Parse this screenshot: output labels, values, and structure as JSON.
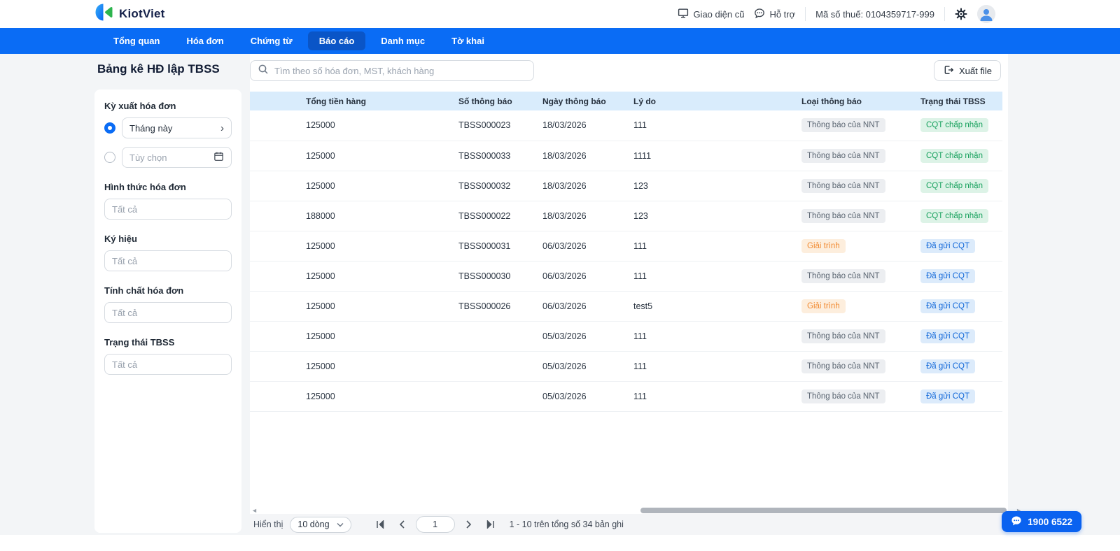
{
  "header": {
    "brand": "KiotViet",
    "old_ui": "Giao diện cũ",
    "support": "Hỗ trợ",
    "tax_code": "Mã số thuế: 0104359717-999"
  },
  "nav": {
    "items": [
      {
        "label": "Tổng quan",
        "active": false
      },
      {
        "label": "Hóa đơn",
        "active": false
      },
      {
        "label": "Chứng từ",
        "active": false
      },
      {
        "label": "Báo cáo",
        "active": true
      },
      {
        "label": "Danh mục",
        "active": false
      },
      {
        "label": "Tờ khai",
        "active": false
      }
    ]
  },
  "page": {
    "title": "Bảng kê HĐ lập TBSS",
    "search_placeholder": "Tìm theo số hóa đơn, MST, khách hàng",
    "export_label": "Xuất file"
  },
  "filters": {
    "period": {
      "label": "Kỳ xuất hóa đơn",
      "this_month": "Tháng này",
      "custom": "Tùy chọn"
    },
    "groups": [
      {
        "label": "Hình thức hóa đơn",
        "placeholder": "Tất cả"
      },
      {
        "label": "Ký hiệu",
        "placeholder": "Tất cả"
      },
      {
        "label": "Tính chất hóa đơn",
        "placeholder": "Tất cả"
      },
      {
        "label": "Trạng thái TBSS",
        "placeholder": "Tất cả"
      }
    ]
  },
  "table": {
    "columns": [
      "Tổng tiền hàng",
      "Số thông báo",
      "Ngày thông báo",
      "Lý do",
      "Loại thông báo",
      "Trạng thái TBSS"
    ],
    "rows": [
      {
        "total": "125000",
        "notice_no": "TBSS000023",
        "date": "18/03/2026",
        "reason": "111",
        "type": "Thông báo của NNT",
        "type_variant": "gray",
        "status": "CQT chấp nhận",
        "status_variant": "green"
      },
      {
        "total": "125000",
        "notice_no": "TBSS000033",
        "date": "18/03/2026",
        "reason": "1111",
        "type": "Thông báo của NNT",
        "type_variant": "gray",
        "status": "CQT chấp nhận",
        "status_variant": "green"
      },
      {
        "total": "125000",
        "notice_no": "TBSS000032",
        "date": "18/03/2026",
        "reason": "123",
        "type": "Thông báo của NNT",
        "type_variant": "gray",
        "status": "CQT chấp nhận",
        "status_variant": "green"
      },
      {
        "total": "188000",
        "notice_no": "TBSS000022",
        "date": "18/03/2026",
        "reason": "123",
        "type": "Thông báo của NNT",
        "type_variant": "gray",
        "status": "CQT chấp nhận",
        "status_variant": "green"
      },
      {
        "total": "125000",
        "notice_no": "TBSS000031",
        "date": "06/03/2026",
        "reason": "111",
        "type": "Giải trình",
        "type_variant": "orange",
        "status": "Đã gửi CQT",
        "status_variant": "blue"
      },
      {
        "total": "125000",
        "notice_no": "TBSS000030",
        "date": "06/03/2026",
        "reason": "111",
        "type": "Thông báo của NNT",
        "type_variant": "gray",
        "status": "Đã gửi CQT",
        "status_variant": "blue"
      },
      {
        "total": "125000",
        "notice_no": "TBSS000026",
        "date": "06/03/2026",
        "reason": "test5",
        "type": "Giải trình",
        "type_variant": "orange",
        "status": "Đã gửi CQT",
        "status_variant": "blue"
      },
      {
        "total": "125000",
        "notice_no": "",
        "date": "05/03/2026",
        "reason": "111",
        "type": "Thông báo của NNT",
        "type_variant": "gray",
        "status": "Đã gửi CQT",
        "status_variant": "blue"
      },
      {
        "total": "125000",
        "notice_no": "",
        "date": "05/03/2026",
        "reason": "111",
        "type": "Thông báo của NNT",
        "type_variant": "gray",
        "status": "Đã gửi CQT",
        "status_variant": "blue"
      },
      {
        "total": "125000",
        "notice_no": "",
        "date": "05/03/2026",
        "reason": "111",
        "type": "Thông báo của NNT",
        "type_variant": "gray",
        "status": "Đã gửi CQT",
        "status_variant": "blue"
      }
    ]
  },
  "pagination": {
    "show_label": "Hiển thị",
    "page_size": "10 dòng",
    "current_page": "1",
    "records_info": "1 - 10 trên tổng số 34 bản ghi"
  },
  "support_fab": {
    "phone": "1900 6522"
  },
  "colors": {
    "brand_blue": "#0a6cf5",
    "nav_active": "#0a55c7",
    "table_header_bg": "#d9ecfc",
    "badge_gray_bg": "#eceef1",
    "badge_gray_text": "#5b6672",
    "badge_green_bg": "#ddf3e7",
    "badge_green_text": "#16a05c",
    "badge_orange_bg": "#fdeedd",
    "badge_orange_text": "#f18b33",
    "badge_blue_bg": "#dcebfb",
    "badge_blue_text": "#1268d9"
  }
}
